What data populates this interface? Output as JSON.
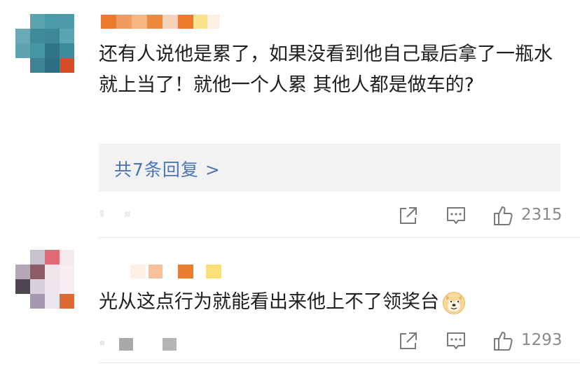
{
  "comments": [
    {
      "text": "还有人说他是累了，如果没看到他自己最后拿了一瓶水就上当了！就他一个人累 其他人都是做车的?",
      "replies_label": "共7条回复 >",
      "likes": "2315"
    },
    {
      "text": "光从这点行为就能看出来他上不了领奖台",
      "likes": "1293"
    }
  ],
  "icons": {
    "share": "share-icon",
    "reply": "comment-icon",
    "like": "thumbs-up-icon",
    "emoji": "doge-emoji-icon"
  },
  "colors": {
    "link": "#4b76b5",
    "reply_bg": "#f2f2f2",
    "muted": "#8a8a8a"
  }
}
